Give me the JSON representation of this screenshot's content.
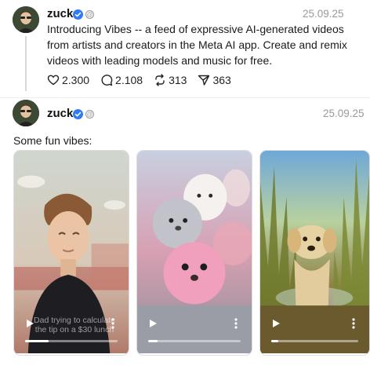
{
  "posts": [
    {
      "username": "zuck",
      "date": "25.09.25",
      "body": "Introducing Vibes -- a feed of expressive AI-generated videos from artists and creators in the Meta AI app. Create and remix videos with leading models and music for free.",
      "stats": {
        "likes": "2.300",
        "replies": "2.108",
        "reposts": "313",
        "shares": "363"
      }
    },
    {
      "username": "zuck",
      "date": "25.09.25",
      "caption": "Some fun vibes:",
      "videos": [
        {
          "subject": "animated man in diner",
          "overlay_text": "Dad trying to calculate the tip on a $30 lunch",
          "progress": 0.25
        },
        {
          "subject": "fluffy pink creatures",
          "overlay_text": "",
          "progress": 0.1
        },
        {
          "subject": "puppy running through grass",
          "overlay_text": "",
          "progress": 0.08
        }
      ]
    }
  ],
  "icons": {
    "like": "heart-icon",
    "reply": "comment-icon",
    "repost": "repost-icon",
    "share": "send-icon",
    "play": "play-icon",
    "more": "more-vertical-icon",
    "verified": "verified-badge-icon"
  },
  "colors": {
    "verified": "#2f7cf6",
    "muted": "#999999",
    "text": "#1a1a1a"
  }
}
